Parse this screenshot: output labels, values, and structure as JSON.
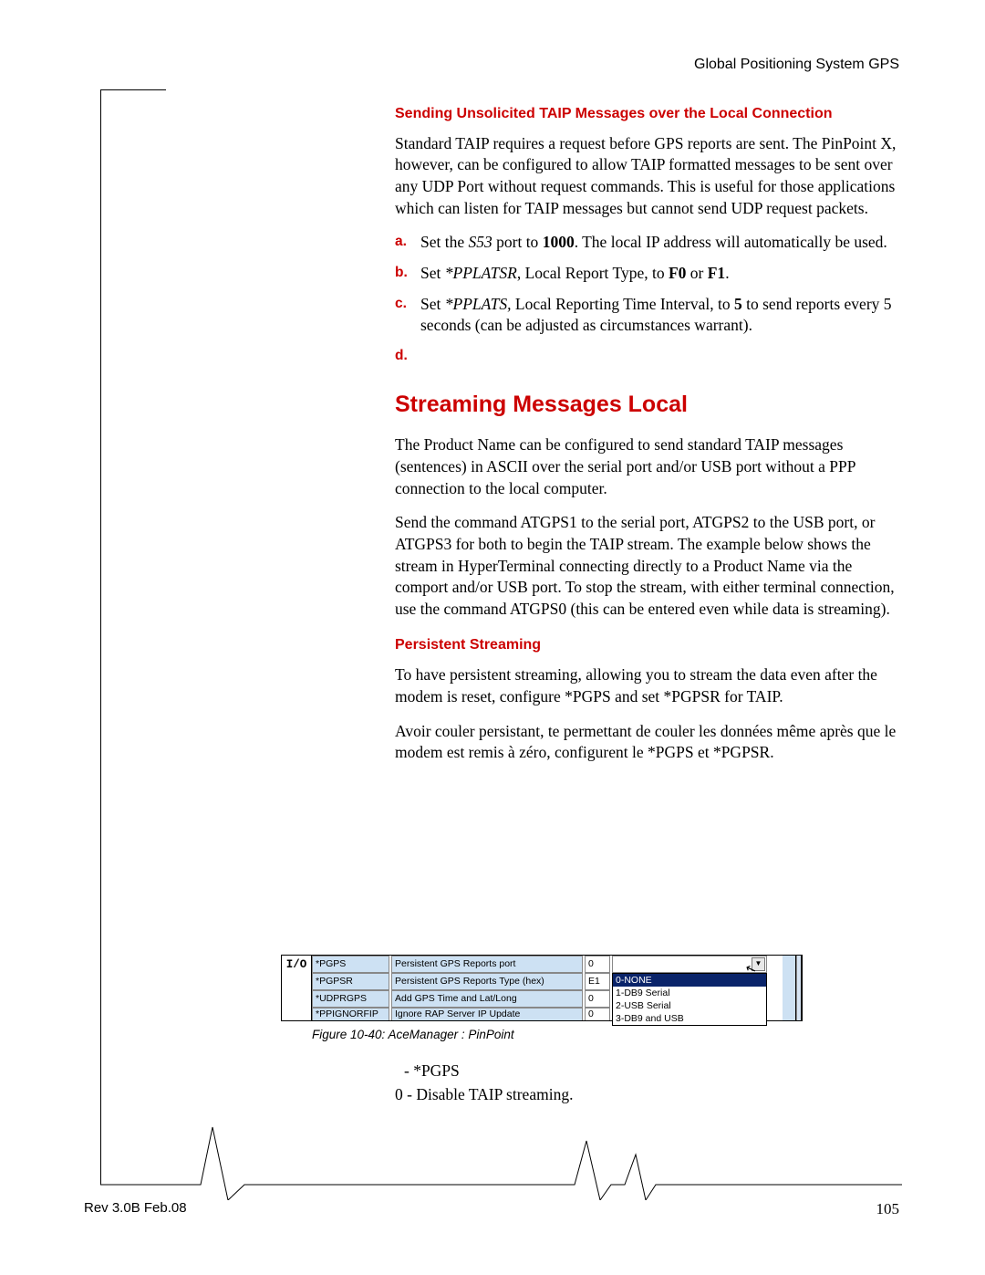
{
  "header": {
    "running": "Global Positioning System GPS"
  },
  "section1": {
    "title": "Sending Unsolicited TAIP Messages over the Local Connection",
    "para": "Standard TAIP requires a request before GPS reports are sent. The PinPoint X, however, can be configured to allow TAIP formatted messages to be sent over any UDP Port without request commands. This is useful for those applications which can listen for TAIP messages but cannot send UDP request packets.",
    "steps": [
      {
        "m": "a.",
        "t": "Set the S53 port to 1000. The local IP address will automatically be used."
      },
      {
        "m": "b.",
        "t": "Set *PPLATSR, Local Report Type, to F0 or F1."
      },
      {
        "m": "c.",
        "t": "Set *PPLATS, Local Reporting Time Interval, to 5 to send reports every 5 seconds (can be adjusted as circumstances warrant)."
      },
      {
        "m": "d.",
        "t": ""
      }
    ]
  },
  "section2": {
    "title": "Streaming Messages Local",
    "p1": "The Product Name can be configured to send standard TAIP messages (sentences) in ASCII over the serial port and/or USB port without a PPP connection to the local computer.",
    "p2": "Send the command ATGPS1 to the serial port, ATGPS2 to the USB port, or ATGPS3 for both to begin the TAIP stream. The example below shows the stream in HyperTerminal connecting directly to a Product Name via the comport and/or USB port. To stop the stream, with either terminal connection, use the command ATGPS0 (this can be entered even while data is streaming)."
  },
  "section3": {
    "title": "Persistent Streaming",
    "p1": "To have persistent streaming, allowing you to stream the data even after the modem is reset, configure *PGPS and set *PGPSR for TAIP.",
    "p2": "Avoir couler persistant, te permettant de couler les données même après que le modem est remis à zéro, configurent le *PGPS et *PGPSR."
  },
  "screenshot": {
    "io": "I/O",
    "rows": [
      {
        "name": "*PGPS",
        "desc": "Persistent GPS Reports port",
        "val": "0",
        "new": ""
      },
      {
        "name": "*PGPSR",
        "desc": "Persistent GPS Reports Type (hex)",
        "val": "E1",
        "new": ""
      },
      {
        "name": "*UDPRGPS",
        "desc": "Add GPS Time and Lat/Long",
        "val": "0",
        "new": ""
      },
      {
        "name": "*PPIGNORFIP",
        "desc": "Ignore RAP Server IP Update",
        "val": "0",
        "new": ""
      }
    ],
    "dropdown": [
      "0-NONE",
      "1-DB9 Serial",
      "2-USB Serial",
      "3-DB9 and USB"
    ],
    "caption": "Figure 10-40: AceManager : PinPoint"
  },
  "post": {
    "l1": " - *PGPS",
    "l2": "0 - Disable TAIP streaming."
  },
  "footer": {
    "left": "Rev 3.0B  Feb.08",
    "right": "105"
  }
}
